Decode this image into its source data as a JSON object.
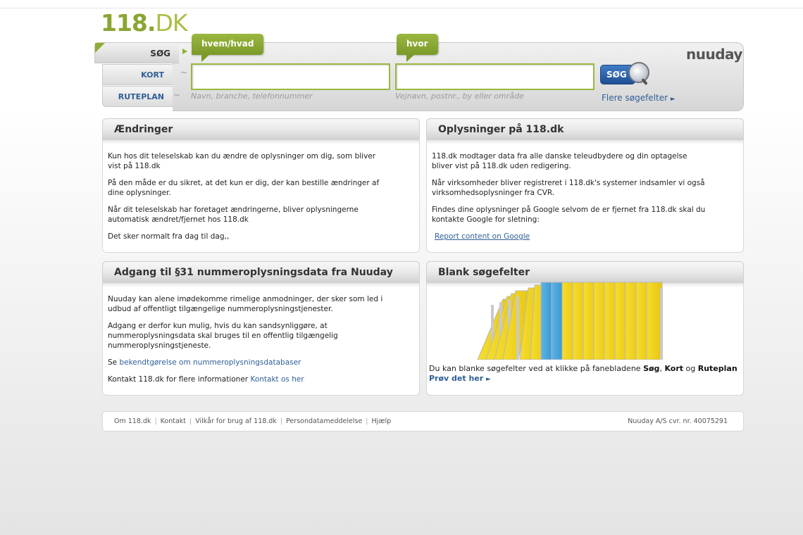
{
  "logo": {
    "num": "118",
    "dot": ".",
    "dk": "DK"
  },
  "brand": "nuuday",
  "tabs": {
    "sog": "SØG",
    "kort": "KORT",
    "ruteplan": "RUTEPLAN"
  },
  "search": {
    "who_label": "hvem/hvad",
    "where_label": "hvor",
    "who_hint": "Navn, branche, telefonnummer",
    "where_hint": "Vejnavn, postnr., by eller område",
    "button": "SØG",
    "more_fields": "Flere søgefelter"
  },
  "box_changes": {
    "title": "Ændringer",
    "p1": "Kun hos dit teleselskab kan du ændre de oplysninger om dig, som bliver vist på 118.dk",
    "p2": "På den måde er du sikret, at det kun er dig, der kan bestille ændringer af dine oplysninger.",
    "p3": "Når dit teleselskab har foretaget ændringerne, bliver oplysningerne automatisk ændret/fjernet hos 118.dk",
    "p4": "Det sker normalt fra dag til dag,,"
  },
  "box_info": {
    "title": "Oplysninger på 118.dk",
    "p1": "118.dk modtager data fra alle danske teleudbydere og din optagelse bliver vist på 118.dk uden redigering.",
    "p2": "Når virksomheder bliver registreret i 118.dk's systemer indsamler vi også virksomhedsoplysninger fra CVR.",
    "p3": "Findes dine oplysninger på Google selvom de er fjernet fra 118.dk skal du kontakte Google for sletning:",
    "link": "Report content on Google"
  },
  "box_access": {
    "title": "Adgang til §31 nummeroplysningsdata fra Nuuday",
    "p1": "Nuuday kan alene imødekomme rimelige anmodninger, der sker som led i udbud af offentligt tilgængelige nummeroplysningstjenester.",
    "p2": "Adgang er derfor kun mulig, hvis du kan sandsynliggøre, at nummeroplysningsdata skal bruges til en offentlig tilgængelig nummeroplysningstjeneste.",
    "p3_prefix": "Se",
    "p3_link": "bekendtgørelse om nummeroplysningsdatabaser",
    "p4_prefix": "Kontakt 118.dk for flere informationer",
    "p4_link": "Kontakt os her"
  },
  "box_blank": {
    "title": "Blank søgefelter",
    "text_prefix": "Du kan blanke søgefelter ved at klikke på fanebladene",
    "t1": "Søg",
    "comma": ",",
    "t2": "Kort",
    "og": "og",
    "t3": "Ruteplan",
    "try": "Prøv det her"
  },
  "footer": {
    "links": [
      "Om 118.dk",
      "Kontakt",
      "Vilkår for brug af 118.dk",
      "Persondatameddelelse",
      "Hjælp"
    ],
    "cvr": "Nuuday A/S cvr. nr. 40075291"
  },
  "colors": {
    "green": "#8db034",
    "blue": "#2f5f97",
    "folder_yellow": "#f2d21e",
    "folder_blue": "#3f9fd8"
  }
}
